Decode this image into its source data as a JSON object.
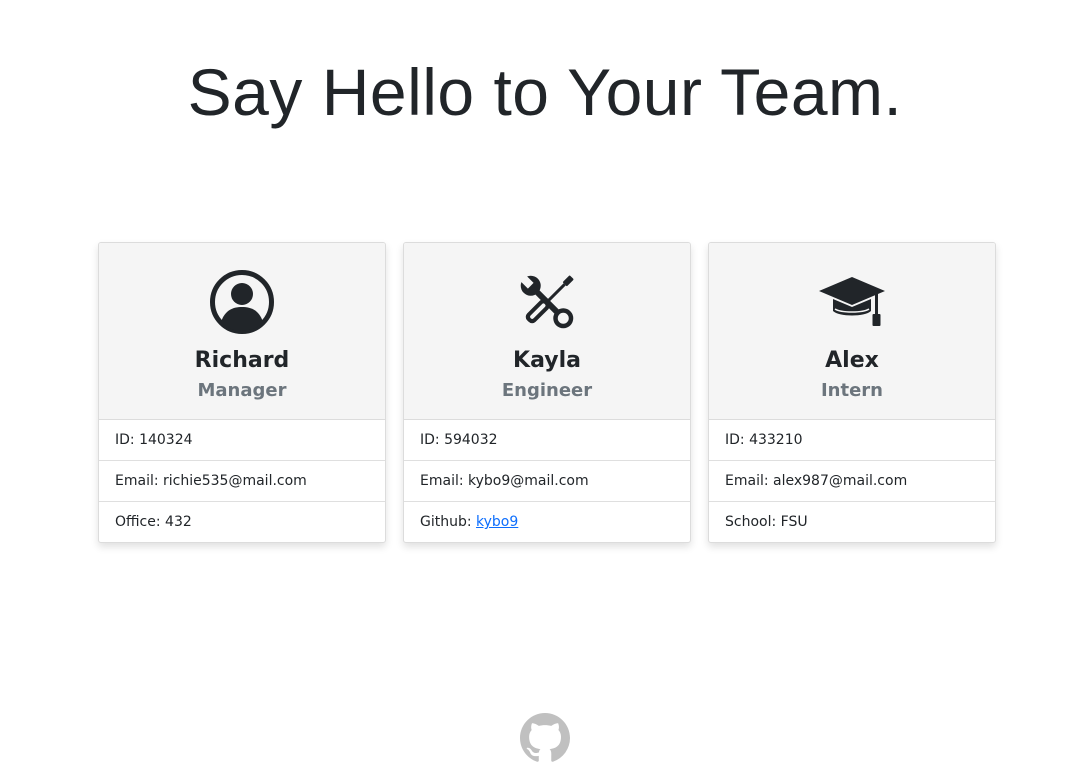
{
  "header": {
    "title": "Say Hello to Your Team."
  },
  "team": [
    {
      "name": "Richard",
      "role": "Manager",
      "icon": "user-circle-icon",
      "id_label": "ID: 140324",
      "email_prefix": "Email: ",
      "email": "richie535@mail.com",
      "extra_prefix": "Office: ",
      "extra_value": "432"
    },
    {
      "name": "Kayla",
      "role": "Engineer",
      "icon": "tools-icon",
      "id_label": "ID: 594032",
      "email_prefix": "Email: ",
      "email": "kybo9@mail.com",
      "extra_prefix": "Github: ",
      "extra_value": "kybo9"
    },
    {
      "name": "Alex",
      "role": "Intern",
      "icon": "graduation-cap-icon",
      "id_label": "ID: 433210",
      "email_prefix": "Email: ",
      "email": "alex987@mail.com",
      "extra_prefix": "School: ",
      "extra_value": "FSU"
    }
  ],
  "footer": {
    "icon": "github-icon"
  },
  "colors": {
    "text": "#212529",
    "muted": "#6c757d",
    "link": "#0d6efd",
    "card_header_bg": "#f5f5f5",
    "footer_icon": "#c0c0c0"
  }
}
